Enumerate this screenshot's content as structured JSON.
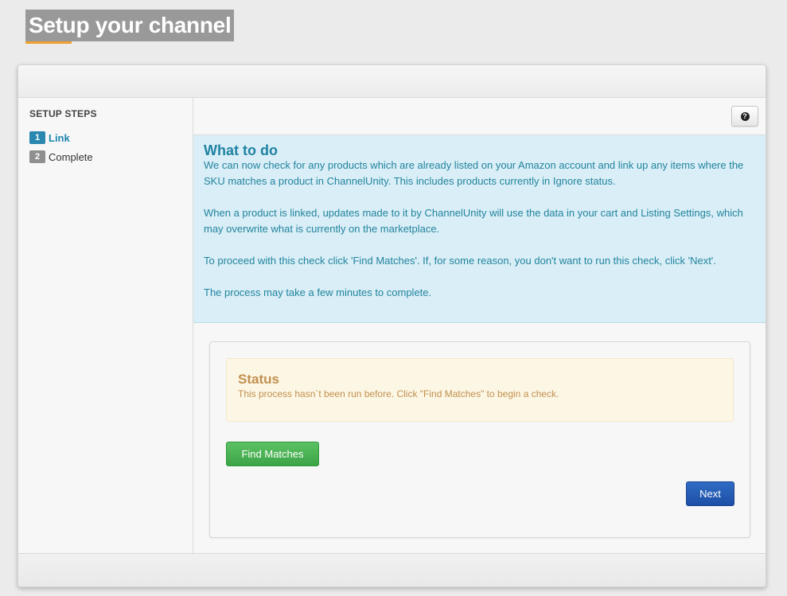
{
  "page": {
    "title": "Setup your channel"
  },
  "sidebar": {
    "heading": "SETUP STEPS",
    "steps": [
      {
        "number": "1",
        "label": "Link",
        "active": true
      },
      {
        "number": "2",
        "label": "Complete",
        "active": false
      }
    ]
  },
  "toolbar": {
    "help_icon": "question-circle-icon",
    "help_glyph": "?"
  },
  "info": {
    "title": "What to do",
    "paragraphs": [
      "We can now check for any products which are already listed on your Amazon account and link up any items where the SKU matches a product in ChannelUnity. This includes products currently in Ignore status.",
      "When a product is linked, updates made to it by ChannelUnity will use the data in your cart and Listing Settings, which may overwrite what is currently on the marketplace.",
      "To proceed with this check click 'Find Matches'. If, for some reason, you don't want to run this check, click 'Next'.",
      "The process may take a few minutes to complete."
    ]
  },
  "status": {
    "title": "Status",
    "message": "This process hasn`t been run before. Click \"Find Matches\" to begin a check."
  },
  "buttons": {
    "find_matches": "Find Matches",
    "next": "Next"
  },
  "colors": {
    "title_bg": "#999999",
    "title_accent": "#f0a030",
    "info_bg": "#d9eef6",
    "info_text": "#22849f",
    "status_bg": "#fcf6e4",
    "status_text": "#c29050",
    "success_button": "#3ca546",
    "primary_button": "#1e4fa6",
    "active_step": "#2a87b0"
  }
}
